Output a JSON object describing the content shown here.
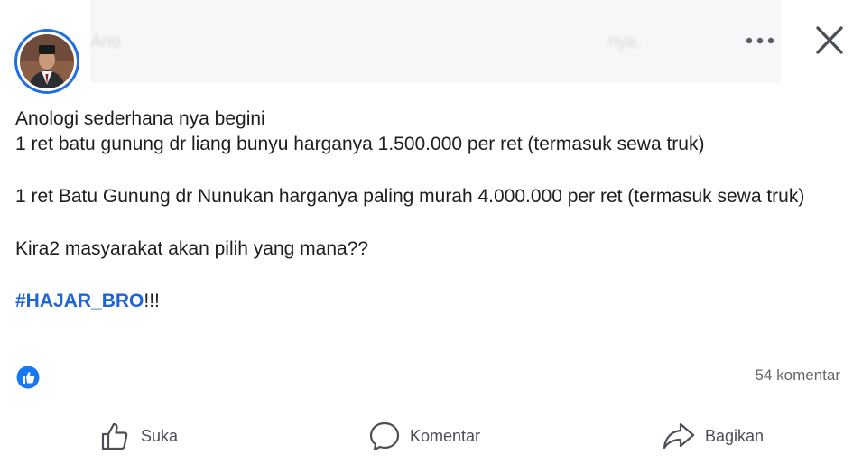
{
  "header": {
    "blurred_left": "Ano",
    "blurred_right": "nya."
  },
  "post": {
    "lines": [
      "Anologi sederhana nya begini",
      "1 ret batu gunung dr liang bunyu harganya 1.500.000 per ret (termasuk sewa truk)",
      "1 ret Batu Gunung dr Nunukan harganya paling murah 4.000.000 per ret (termasuk sewa truk)",
      "Kira2 masyarakat akan pilih yang mana??"
    ],
    "hashtag": "#HAJAR_BRO",
    "hashtag_suffix": "!!!"
  },
  "stats": {
    "comments": "54 komentar"
  },
  "actions": {
    "like": "Suka",
    "comment": "Komentar",
    "share": "Bagikan"
  },
  "colors": {
    "accent": "#1f64d6",
    "text": "#1c1e21",
    "muted": "#65676b",
    "avatar_ring": "#1f6fe0"
  },
  "icons": [
    "more-icon",
    "close-icon",
    "like-reaction-icon",
    "thumbs-up-icon",
    "comment-bubble-icon",
    "share-arrow-icon"
  ]
}
